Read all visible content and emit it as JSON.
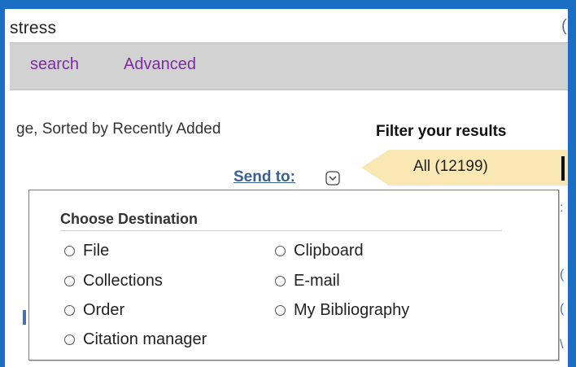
{
  "search": {
    "query_fragment": "stress"
  },
  "nav": {
    "search_label": "search",
    "advanced_label": "Advanced"
  },
  "results": {
    "sort_text": "ge, Sorted by Recently Added"
  },
  "filter": {
    "title": "Filter your results",
    "all_label": "All (12199)",
    "tab_color": "#fae8b4"
  },
  "send_to": {
    "label": "Send to:"
  },
  "destination": {
    "title": "Choose Destination",
    "options": [
      "File",
      "Clipboard",
      "Collections",
      "E-mail",
      "Order",
      "My Bibliography",
      "Citation manager"
    ]
  },
  "colors": {
    "page_border": "#1a6fc4",
    "nav_link": "#7a2d9c",
    "send_to_link": "#3a5f95"
  },
  "icons": {
    "send_to_dropdown": "chevron-down-icon",
    "radio": "radio-button-icon"
  }
}
